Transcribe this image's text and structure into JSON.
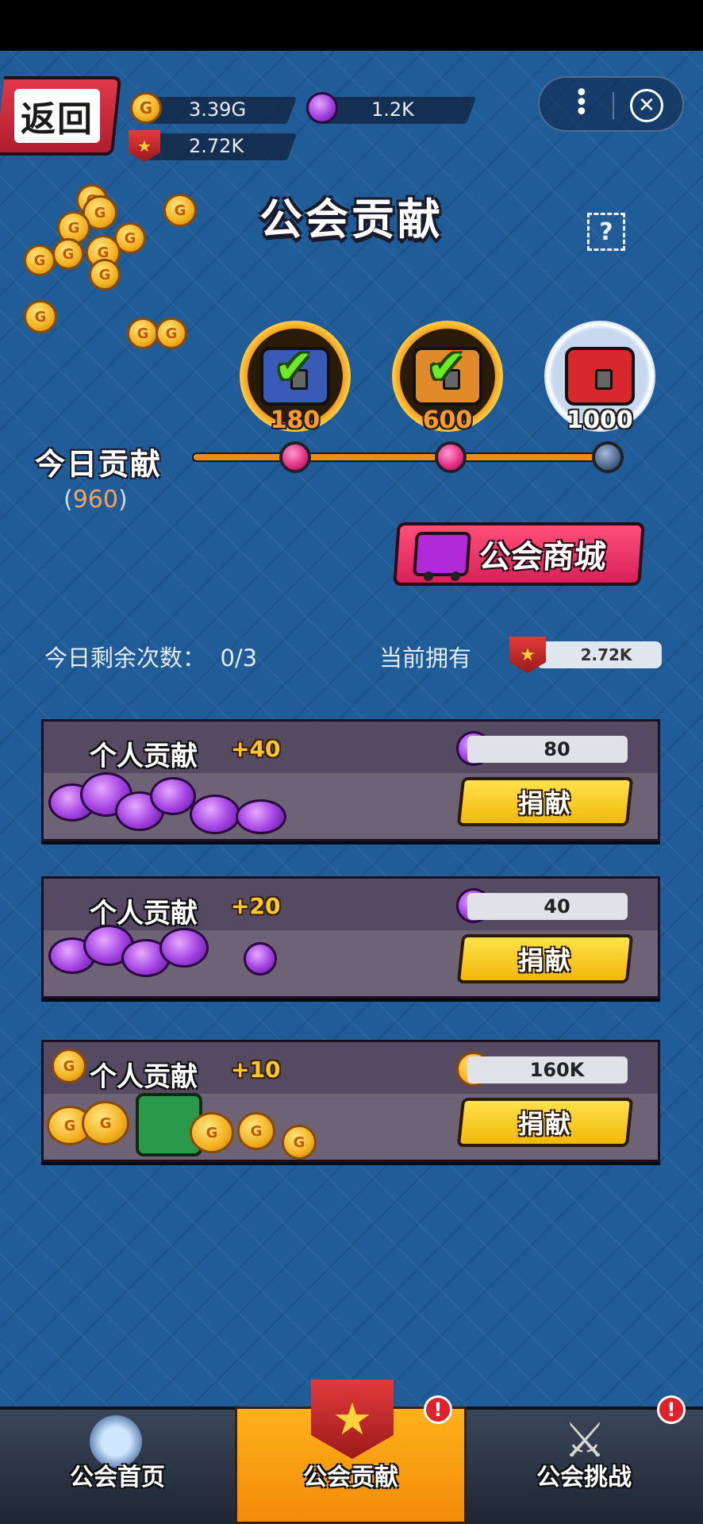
{
  "header": {
    "back_label": "返回",
    "gold": "3.39G",
    "gems": "1.2K",
    "contribution": "2.72K"
  },
  "title": "公会贡献",
  "help_icon_glyph": "?",
  "milestones": [
    {
      "value": "180",
      "claimed": true,
      "color": "#3a5ab8"
    },
    {
      "value": "600",
      "claimed": true,
      "color": "#e08a2a"
    },
    {
      "value": "1000",
      "claimed": false,
      "color": "#d8282e"
    }
  ],
  "today": {
    "label": "今日贡献",
    "value_prefix": "(",
    "value": "960",
    "value_suffix": ")",
    "progress_fraction": 0.96
  },
  "shop_button_label": "公会商城",
  "remaining": {
    "label": "今日剩余次数：",
    "value": "0/3"
  },
  "owned": {
    "label": "当前拥有",
    "value": "2.72K"
  },
  "donations": [
    {
      "title": "个人贡献",
      "bonus": "+40",
      "cost": "80",
      "currency": "gem",
      "button": "捐献"
    },
    {
      "title": "个人贡献",
      "bonus": "+20",
      "cost": "40",
      "currency": "gem",
      "button": "捐献"
    },
    {
      "title": "个人贡献",
      "bonus": "+10",
      "cost": "160K",
      "currency": "gold",
      "button": "捐献"
    }
  ],
  "nav": [
    {
      "label": "公会首页",
      "active": false,
      "alert": false
    },
    {
      "label": "公会贡献",
      "active": true,
      "alert": true
    },
    {
      "label": "公会挑战",
      "active": false,
      "alert": true
    }
  ],
  "alert_glyph": "!",
  "colors": {
    "background": "#1f5c98",
    "progress": "#f08a1c",
    "button_yellow": "#f2b80a",
    "shop_pink": "#d8205a"
  }
}
